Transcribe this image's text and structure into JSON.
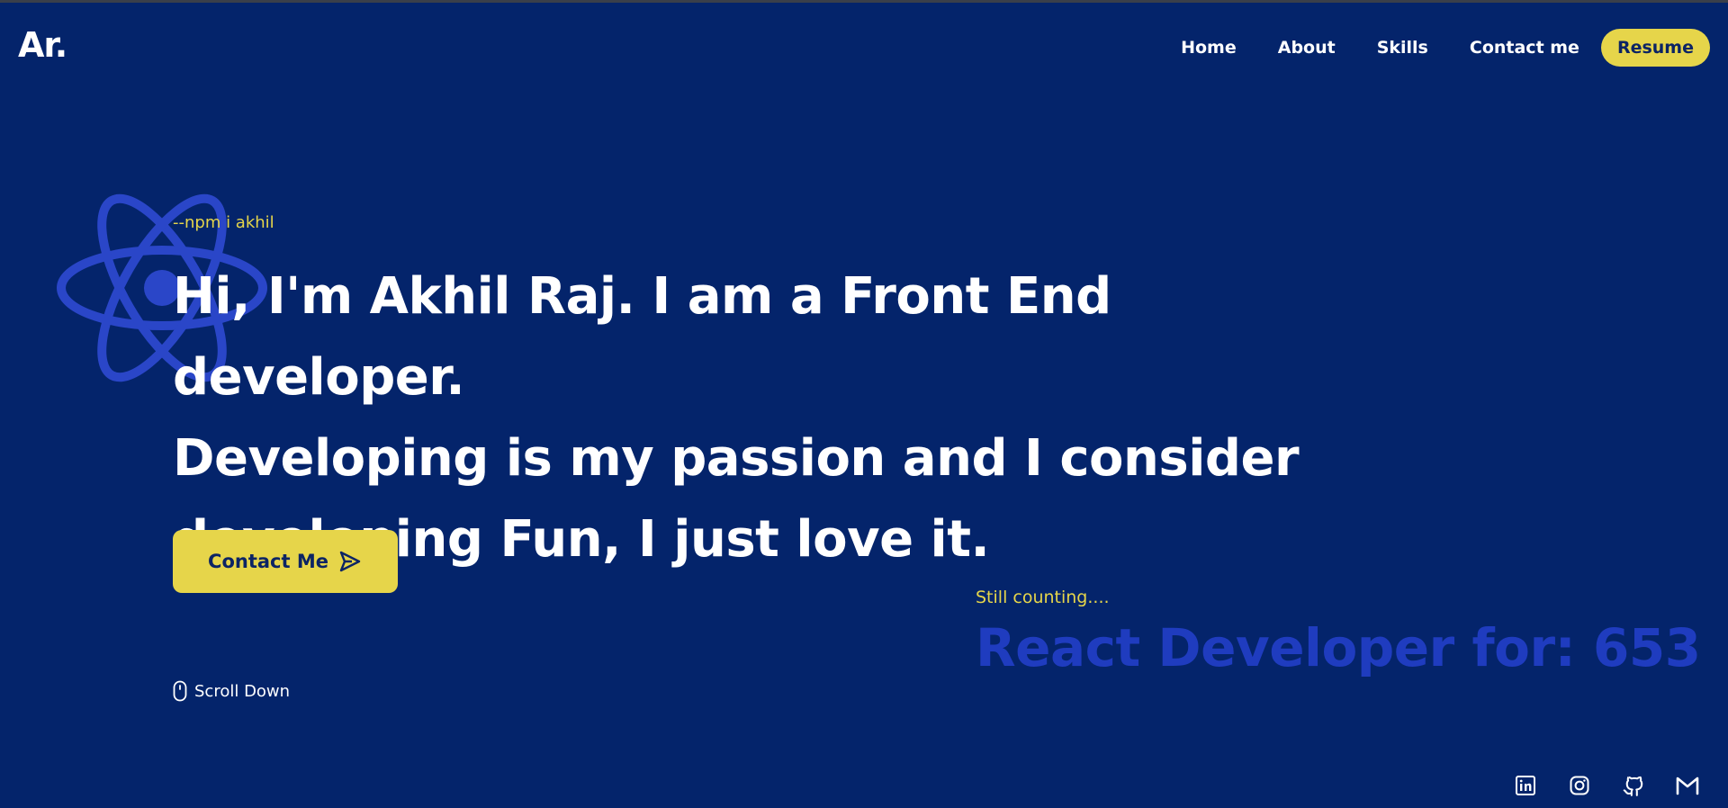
{
  "header": {
    "logo": "Ar.",
    "nav": [
      {
        "label": "Home"
      },
      {
        "label": "About"
      },
      {
        "label": "Skills"
      },
      {
        "label": "Contact me"
      }
    ],
    "resume_label": "Resume"
  },
  "hero": {
    "prefix": "--npm i akhil",
    "headline_lines": [
      "Hi, I'm Akhil Raj. I am a Front End developer.",
      "Developing is my passion and I consider",
      "developing Fun, I just love it."
    ],
    "contact_button": "Contact Me",
    "scroll_label": "Scroll Down"
  },
  "counter": {
    "label": "Still counting....",
    "text": "React Developer for: 653"
  },
  "socials": [
    {
      "icon": "linkedin-icon"
    },
    {
      "icon": "instagram-icon"
    },
    {
      "icon": "github-icon"
    },
    {
      "icon": "gmail-icon"
    }
  ],
  "colors": {
    "background": "#04246b",
    "accent": "#e6d54a",
    "counter": "#1f3cbf",
    "atom": "#2a46c8"
  }
}
